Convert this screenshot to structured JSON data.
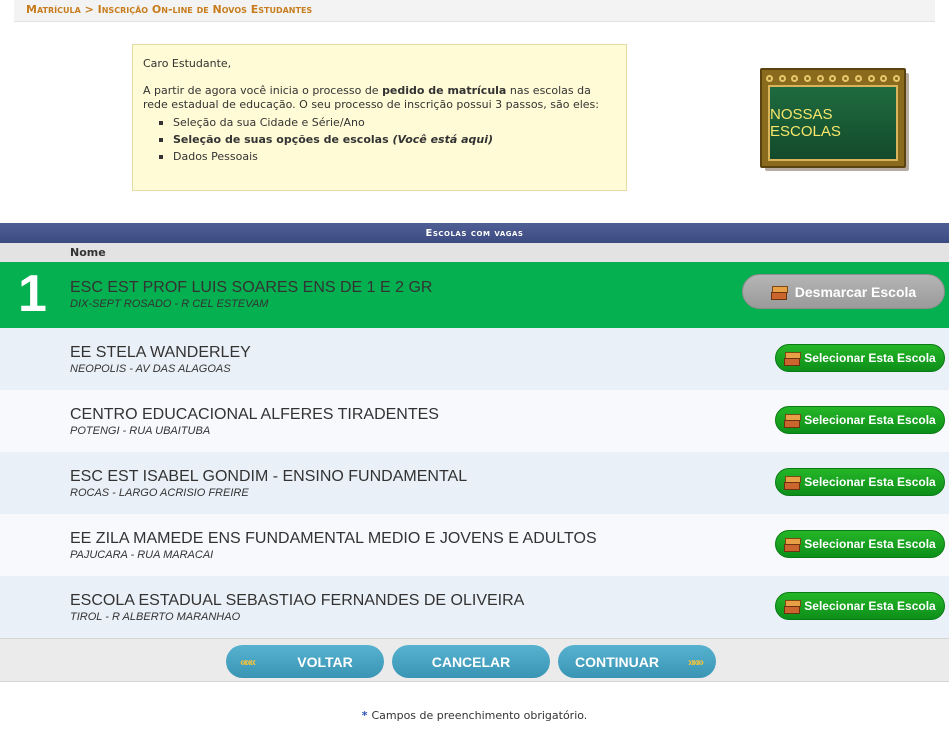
{
  "breadcrumb": "Matrícula > Inscrição On-line de Novos Estudantes",
  "intro": {
    "greeting": "Caro Estudante,",
    "text_before": "A partir de agora você inicia o processo de ",
    "text_bold": "pedido de matrícula",
    "text_after": " nas escolas da rede estadual de educação. O seu processo de inscrição possui 3 passos, são eles:",
    "steps": [
      {
        "label": "Seleção da sua Cidade e Série/Ano"
      },
      {
        "label": "Seleção de suas opções de escolas",
        "note": "(Você está aqui)"
      },
      {
        "label": "Dados Pessoais"
      }
    ]
  },
  "board": {
    "label": "NOSSAS ESCOLAS"
  },
  "table": {
    "title": "Escolas com vagas",
    "header_name": "Nome",
    "rows": [
      {
        "number": "1",
        "name": "ESC EST PROF LUIS SOARES ENS DE 1 E 2 GR",
        "address": "DIX-SEPT ROSADO - R CEL ESTEVAM",
        "button": "Desmarcar Escola"
      },
      {
        "name": "EE STELA WANDERLEY",
        "address": "NEOPOLIS - AV DAS ALAGOAS",
        "button": "Selecionar Esta Escola"
      },
      {
        "name": "CENTRO EDUCACIONAL ALFERES TIRADENTES",
        "address": "POTENGI - RUA UBAITUBA",
        "button": "Selecionar Esta Escola"
      },
      {
        "name": "ESC EST ISABEL GONDIM - ENSINO FUNDAMENTAL",
        "address": "ROCAS - LARGO ACRISIO FREIRE",
        "button": "Selecionar Esta Escola"
      },
      {
        "name": "EE ZILA MAMEDE ENS FUNDAMENTAL MEDIO E JOVENS E ADULTOS",
        "address": "PAJUCARA - RUA MARACAI",
        "button": "Selecionar Esta Escola"
      },
      {
        "name": "ESCOLA ESTADUAL SEBASTIAO FERNANDES DE OLIVEIRA",
        "address": "TIROL - R ALBERTO MARANHAO",
        "button": "Selecionar Esta Escola"
      }
    ]
  },
  "footer": {
    "back": "VOLTAR",
    "cancel": "CANCELAR",
    "continue": "CONTINUAR",
    "note_star": "*",
    "note": "Campos de preenchimento obrigatório."
  },
  "colors": {
    "selected_row": "#05b050",
    "select_button": "#18a21f",
    "footer_button": "#48a4c3",
    "breadcrumb": "#c77d1e",
    "table_title": "#46558b"
  },
  "icons": [
    "books-icon",
    "double-chevron-left-icon",
    "double-chevron-right-icon",
    "chalkboard-icon"
  ]
}
